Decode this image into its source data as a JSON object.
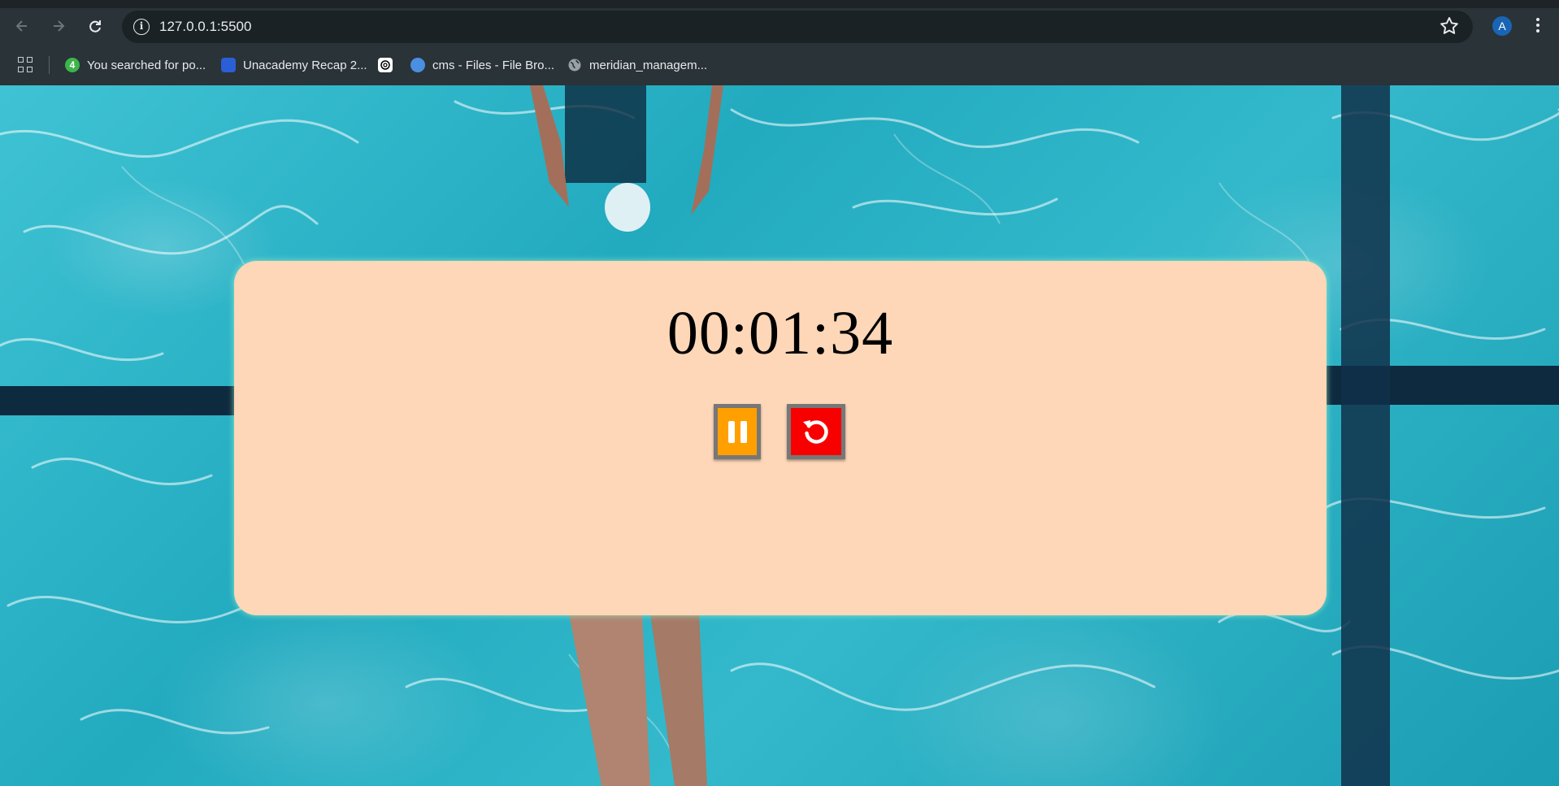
{
  "browser": {
    "url": "127.0.0.1:5500",
    "profile_initial": "A",
    "bookmarks": [
      {
        "label": "You searched for po...",
        "icon": "green-4-icon"
      },
      {
        "label": "Unacademy Recap 2...",
        "icon": "unacademy-icon"
      },
      {
        "label": "",
        "icon": "openai-icon"
      },
      {
        "label": "cms - Files - File Bro...",
        "icon": "cms-icon"
      },
      {
        "label": "meridian_managem...",
        "icon": "globe-icon"
      }
    ]
  },
  "stopwatch": {
    "time": "00:01:34",
    "pause_icon": "pause-icon",
    "reset_icon": "reset-icon"
  },
  "colors": {
    "card": "#fdd7b7",
    "pause_button": "#ffa000",
    "reset_button": "#f80000"
  }
}
